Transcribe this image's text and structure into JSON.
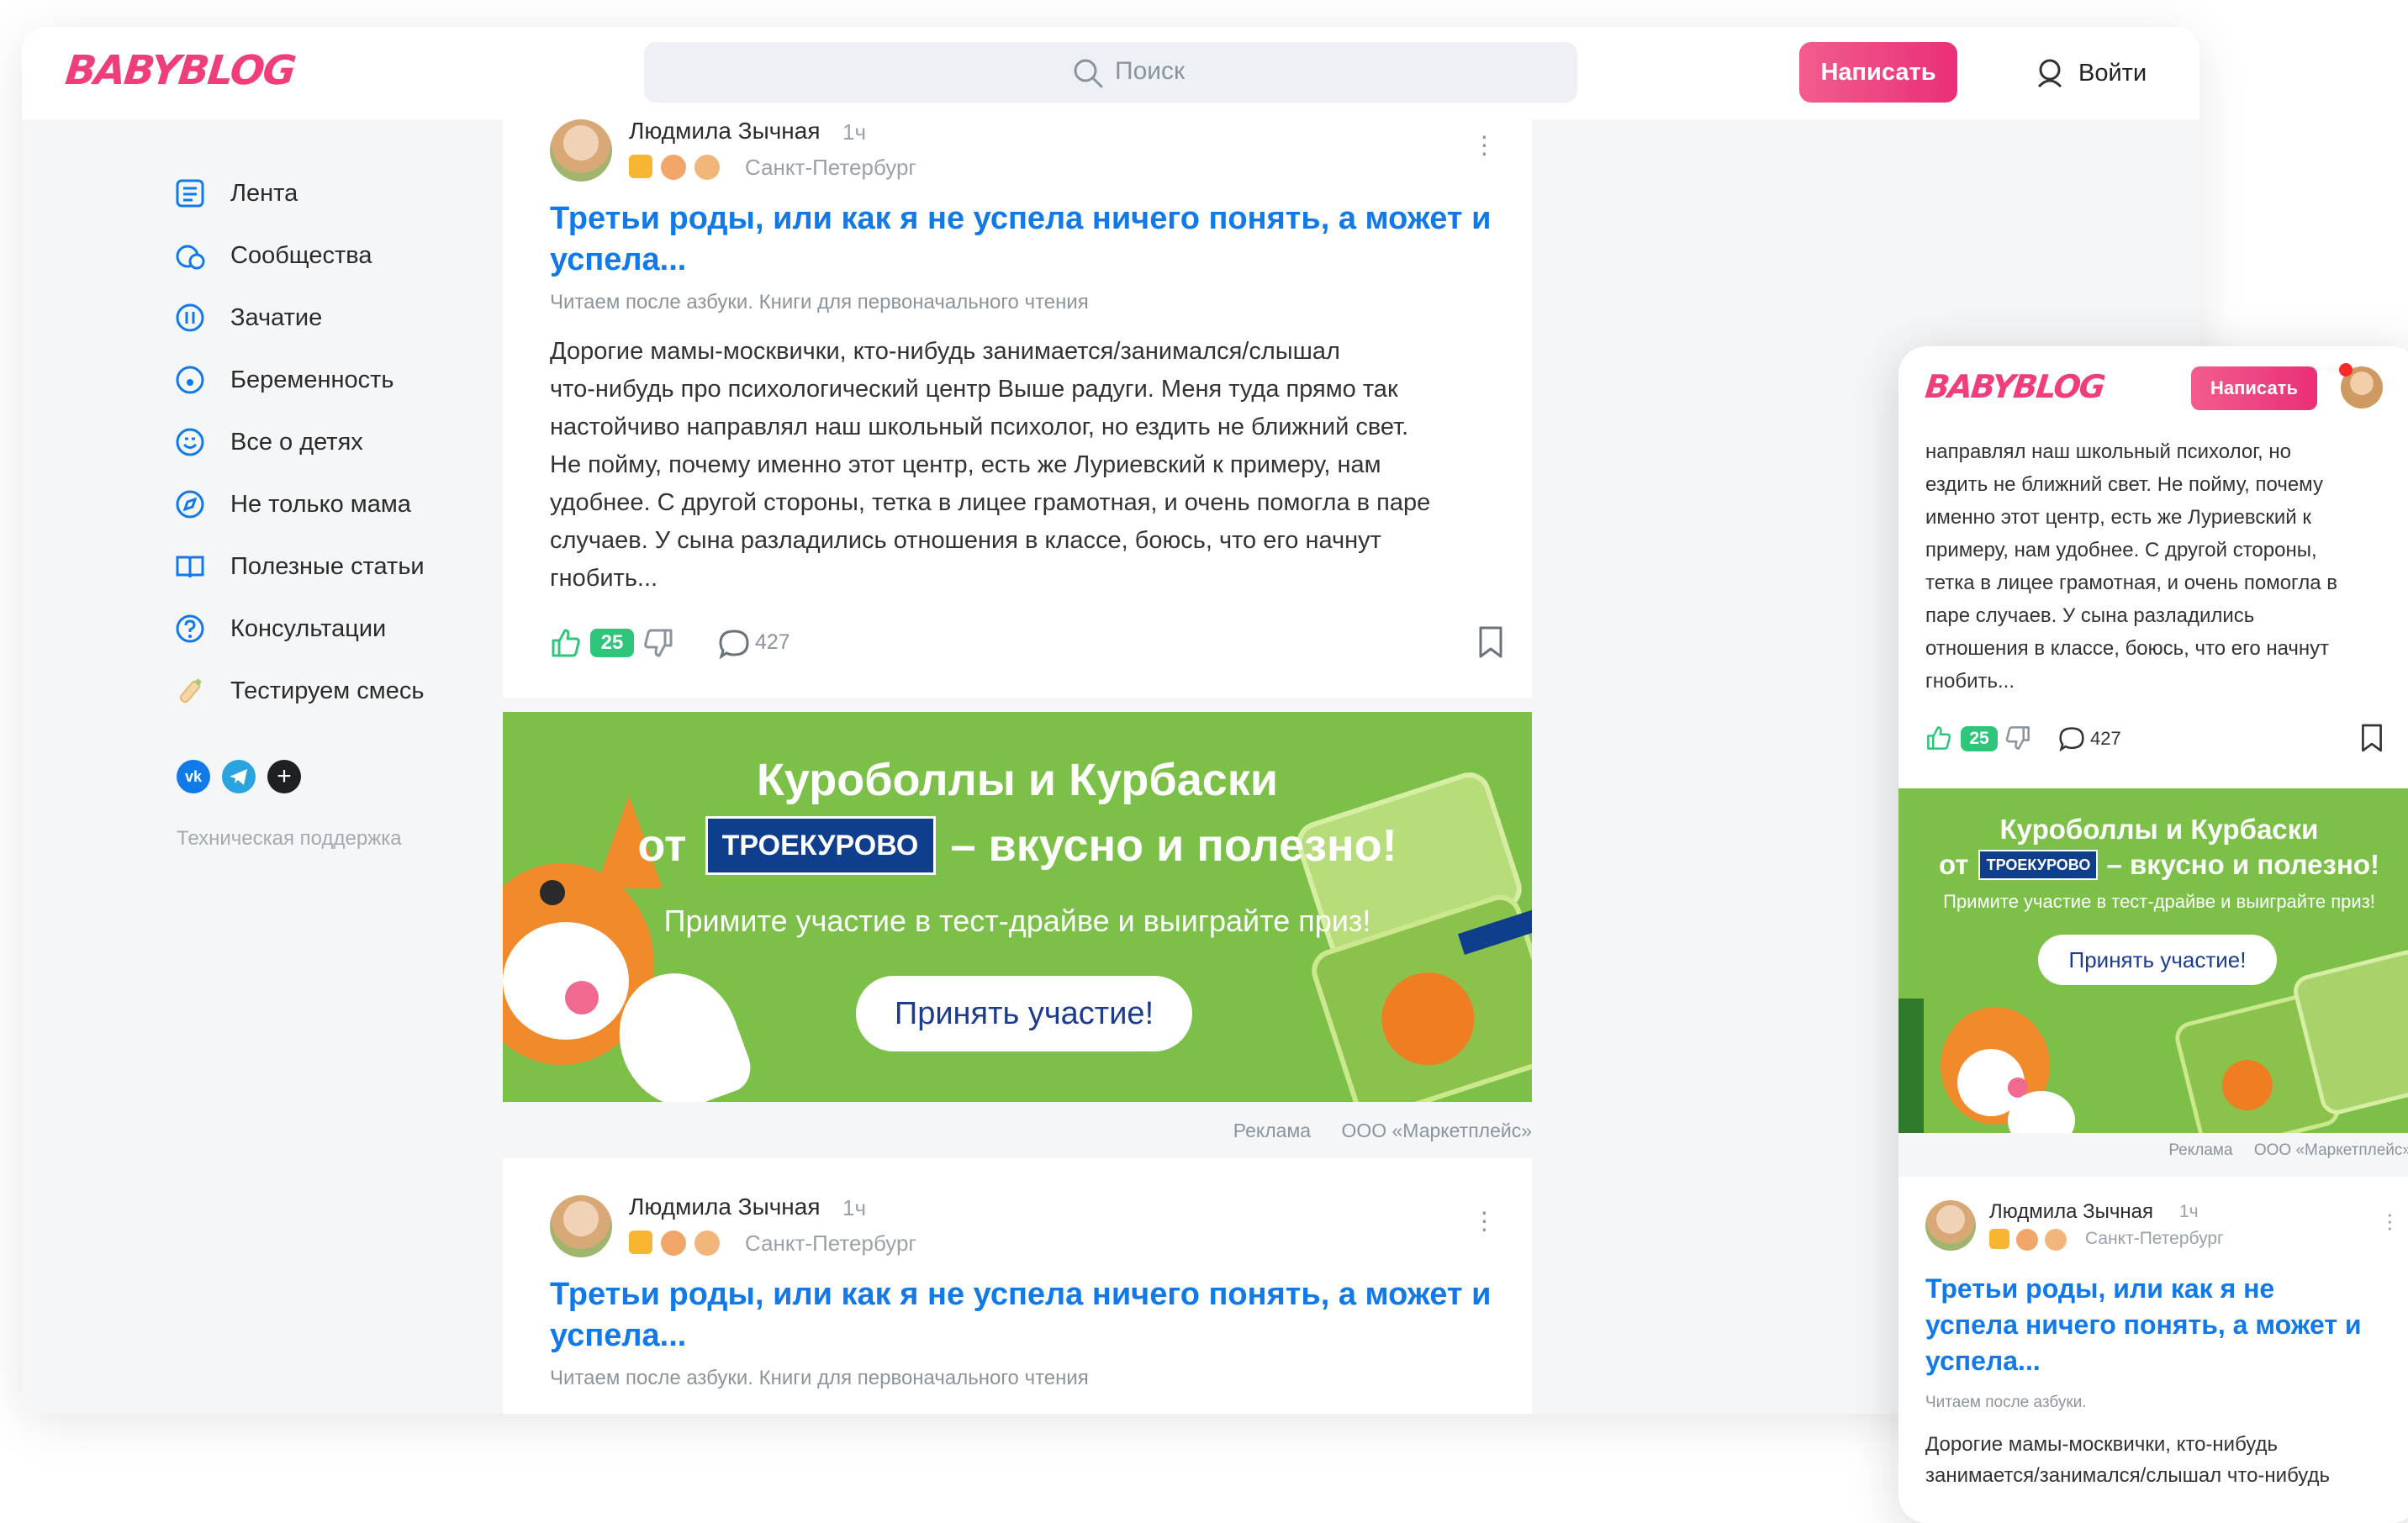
{
  "brand": {
    "logo_text": "BABYBLOG",
    "accent": "#ef3e7b",
    "link_color": "#1279e8",
    "like_green": "#2fc57a",
    "ad_green": "#7cc04a"
  },
  "header": {
    "search_placeholder": "Поиск",
    "write_label": "Написать",
    "login_label": "Войти"
  },
  "sidebar": {
    "items": [
      {
        "label": "Лента",
        "icon": "feed-icon"
      },
      {
        "label": "Сообщества",
        "icon": "community-icon"
      },
      {
        "label": "Зачатие",
        "icon": "conception-icon"
      },
      {
        "label": "Беременность",
        "icon": "pregnancy-icon"
      },
      {
        "label": "Все о детях",
        "icon": "smile-icon"
      },
      {
        "label": "Не только мама",
        "icon": "compass-icon"
      },
      {
        "label": "Полезные статьи",
        "icon": "book-icon"
      },
      {
        "label": "Консультации",
        "icon": "question-icon"
      },
      {
        "label": "Тестируем смесь",
        "icon": "bottle-icon"
      }
    ],
    "social": [
      "vk-icon",
      "telegram-icon",
      "add-icon"
    ],
    "support_label": "Техническая поддержка"
  },
  "post": {
    "author": "Людмила Зычная",
    "time": "1ч",
    "city": "Санкт-Петербург",
    "title": "Третьи роды, или как я не успела ничего понять, а может и успела...",
    "title_line1": "Третьи роды, или как я не успела ничего понять, а может и",
    "title_line2": "успела...",
    "category": "Читаем после азбуки. Книги для первоначального чтения",
    "body": [
      "Дорогие мамы-москвички, кто-нибудь занимается/занимался/слышал",
      "что-нибудь про психологический центр Выше радуги. Меня туда прямо так",
      "настойчиво направлял наш школьный психолог, но ездить не ближний свет.",
      "Не пойму, почему именно этот центр, есть же Луриевский к примеру, нам",
      "удобнее. С другой стороны, тетка в лицее грамотная, и очень помогла в паре",
      "случаев. У сына разладились отношения в классе, боюсь, что его начнут",
      "гнобить..."
    ],
    "likes": "25",
    "comments": "427"
  },
  "ad": {
    "line1": "Куроболлы и Курбаски",
    "from": "от",
    "brand_label": "ТРОЕКУРОВО",
    "line2_rest": "– вкусно и полезно!",
    "line3": "Примите участие в тест-драйве и выиграйте приз!",
    "cta": "Принять участие!",
    "label": "Реклама",
    "advertiser": "ООО «Маркетплейс»"
  },
  "mobile": {
    "write_label": "Написать",
    "body": [
      "направлял наш школьный психолог, но",
      "ездить не ближний свет. Не пойму, почему",
      "именно этот центр, есть же Луриевский к",
      "примеру, нам удобнее. С другой стороны,",
      "тетка в лицее грамотная, и очень помогла в",
      "паре случаев. У сына разладились",
      "отношения в классе, боюсь, что его начнут",
      "гнобить..."
    ],
    "title_lines": [
      "Третьи роды, или как я не",
      "успела ничего понять, а может и",
      "успела..."
    ],
    "category": "Читаем после азбуки.",
    "preview": [
      "Дорогие мамы-москвички, кто-нибудь",
      "занимается/занимался/слышал что-нибудь"
    ]
  }
}
